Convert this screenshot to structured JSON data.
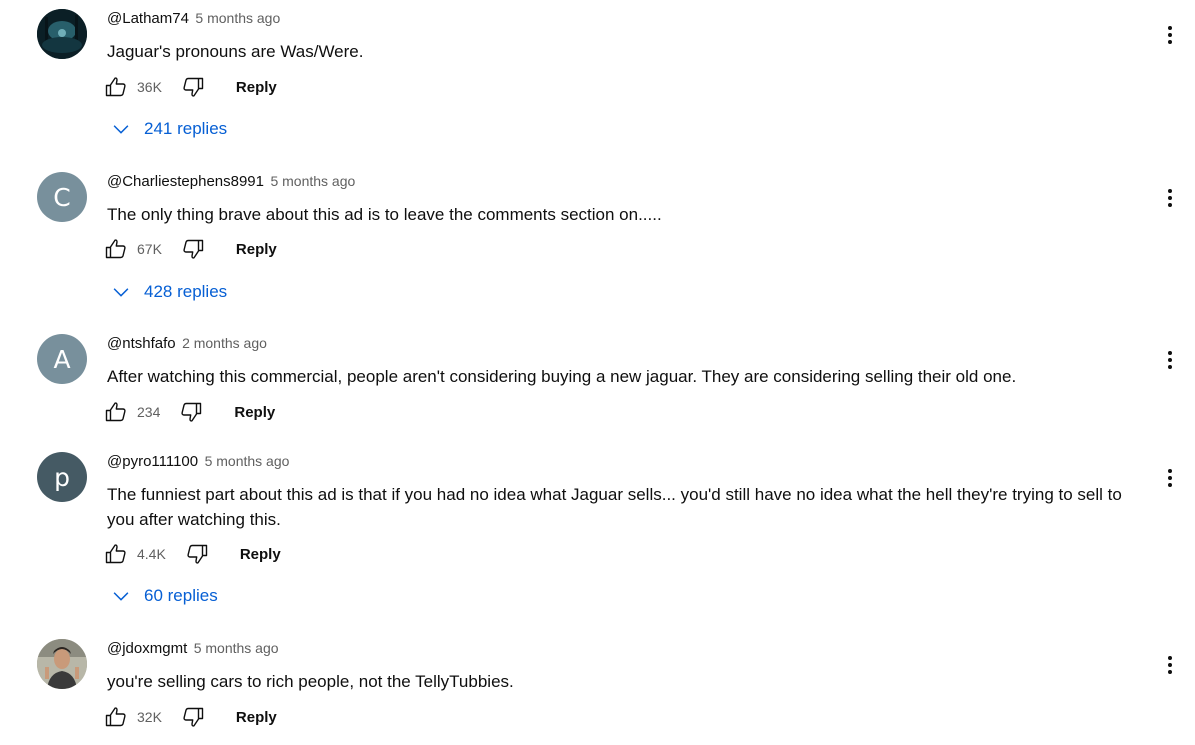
{
  "colors": {
    "link": "#065fd4",
    "muted": "#606060",
    "text": "#0f0f0f"
  },
  "comments": [
    {
      "author": "@Latham74",
      "time": "5 months ago",
      "text": "Jaguar's pronouns are Was/Were.",
      "likes": "36K",
      "reply_label": "Reply",
      "replies": "241 replies",
      "avatar": {
        "type": "image",
        "icon": "dark-forest-avatar-image"
      }
    },
    {
      "author": "@Charliestephens8991",
      "time": "5 months ago",
      "text": "The only thing brave about this ad is to leave the comments section on.....",
      "likes": "67K",
      "reply_label": "Reply",
      "replies": "428 replies",
      "avatar": {
        "type": "letter",
        "letter": "C",
        "color": "#78909c"
      }
    },
    {
      "author": "@ntshfafo",
      "time": "2 months ago",
      "text": "After watching this commercial, people aren't considering buying a new jaguar. They are considering selling their old one.",
      "likes": "234",
      "reply_label": "Reply",
      "avatar": {
        "type": "letter",
        "letter": "A",
        "color": "#78909c"
      }
    },
    {
      "author": "@pyro111100",
      "time": "5 months ago",
      "text": "The funniest part about this ad is that if you had no idea what Jaguar sells... you'd still have no idea what the hell they're trying to sell to you after watching this.",
      "likes": "4.4K",
      "reply_label": "Reply",
      "replies": "60 replies",
      "avatar": {
        "type": "letter",
        "letter": "p",
        "color": "#455a64"
      }
    },
    {
      "author": "@jdoxmgmt",
      "time": "5 months ago",
      "text": "you're selling cars to rich people, not the TellyTubbies.",
      "likes": "32K",
      "reply_label": "Reply",
      "avatar": {
        "type": "image",
        "icon": "person-photo-avatar-image"
      }
    }
  ]
}
